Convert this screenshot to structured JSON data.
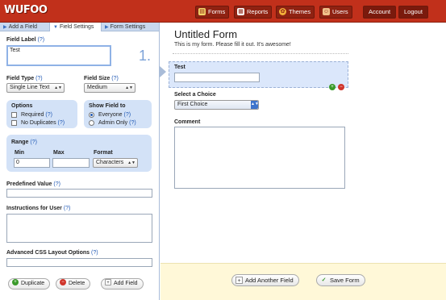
{
  "app": {
    "logo": "WUFOO"
  },
  "nav": {
    "forms": "Forms",
    "reports": "Reports",
    "themes": "Themes",
    "users": "Users",
    "account": "Account",
    "logout": "Logout"
  },
  "tabs": {
    "add_field": "Add a Field",
    "field_settings": "Field Settings",
    "form_settings": "Form Settings"
  },
  "field_settings": {
    "field_label": "Field Label",
    "help": "(?)",
    "field_label_value": "Test",
    "field_number": "1.",
    "field_type_label": "Field Type",
    "field_type_value": "Single Line Text",
    "field_size_label": "Field Size",
    "field_size_value": "Medium",
    "options_label": "Options",
    "required": "Required",
    "no_duplicates": "No Duplicates",
    "show_field_to": "Show Field to",
    "everyone": "Everyone",
    "admin_only": "Admin Only",
    "range_label": "Range",
    "min_label": "Min",
    "max_label": "Max",
    "format_label": "Format",
    "min_value": "0",
    "max_value": "",
    "format_value": "Characters",
    "predefined_value": "Predefined Value",
    "instructions": "Instructions for User",
    "css_options": "Advanced CSS Layout Options",
    "duplicate_btn": "Duplicate",
    "delete_btn": "Delete",
    "add_field_btn": "Add Field"
  },
  "form": {
    "title": "Untitled Form",
    "description": "This is my form. Please fill it out. It's awesome!",
    "field1_label": "Test",
    "field2_label": "Select a Choice",
    "field2_value": "First Choice",
    "field3_label": "Comment",
    "add_another_btn": "Add Another Field",
    "save_btn": "Save Form"
  },
  "colors": {
    "topbar": "#c1301b",
    "panel": "#dfe9f8",
    "footer": "#fff8d8"
  }
}
